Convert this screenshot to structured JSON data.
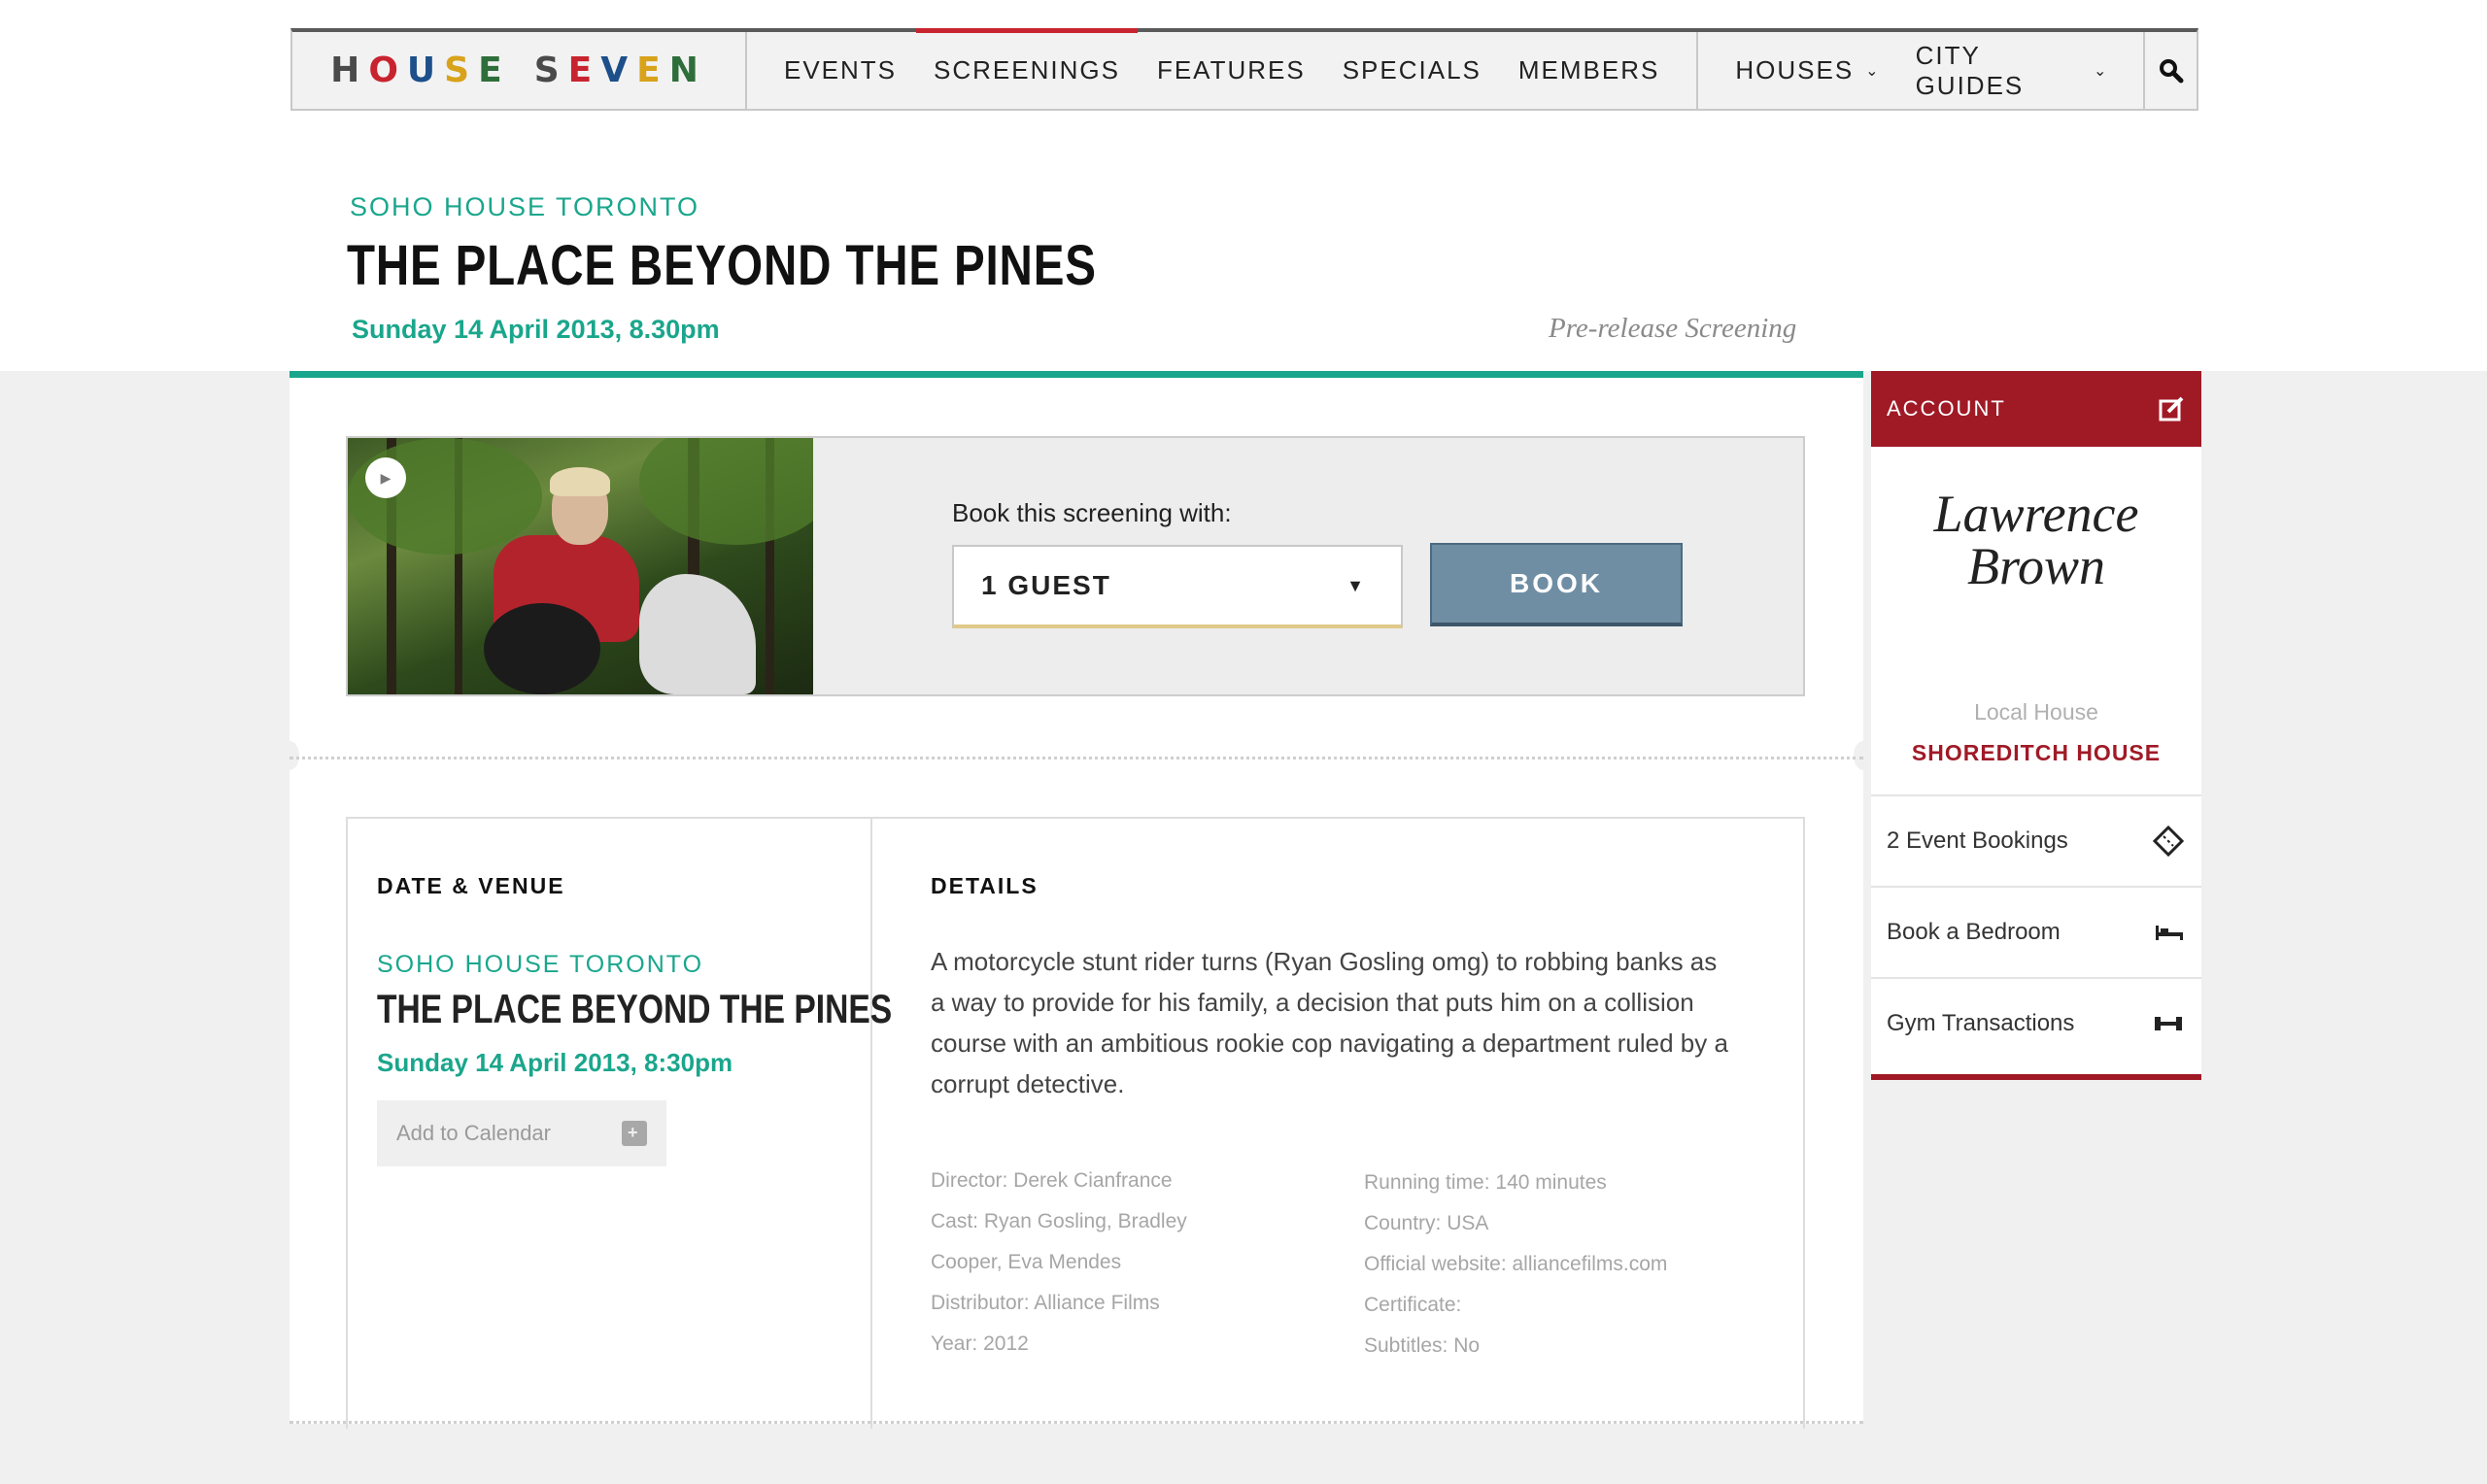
{
  "nav": {
    "logo_letters": [
      "H",
      "O",
      "U",
      "S",
      "E",
      " ",
      "S",
      "E",
      "V",
      "E",
      "N"
    ],
    "logo_colors": [
      "#4a4a4a",
      "#c8242f",
      "#1d4f8a",
      "#d8a21a",
      "#2e6e3a",
      "#000",
      "#4a4a4a",
      "#c8242f",
      "#1d4f8a",
      "#d8a21a",
      "#2e6e3a"
    ],
    "items": [
      "EVENTS",
      "SCREENINGS",
      "FEATURES",
      "SPECIALS",
      "MEMBERS"
    ],
    "active": "SCREENINGS",
    "right": [
      "HOUSES",
      "CITY GUIDES"
    ],
    "search_icon": "search-icon"
  },
  "header": {
    "house": "SOHO HOUSE TORONTO",
    "title": "THE PLACE BEYOND THE PINES",
    "date": "Sunday 14 April 2013, 8.30pm",
    "tag": "Pre-release Screening"
  },
  "booking": {
    "label": "Book this screening with:",
    "guest_value": "1 GUEST",
    "book_label": "BOOK"
  },
  "venue": {
    "heading": "DATE & VENUE",
    "house": "SOHO HOUSE TORONTO",
    "title": "THE PLACE BEYOND THE PINES",
    "date": "Sunday 14 April 2013, 8:30pm",
    "calendar_label": "Add to Calendar"
  },
  "details": {
    "heading": "DETAILS",
    "description": "A motorcycle stunt rider turns (Ryan Gosling omg) to robbing banks as a way to provide for his family, a decision that puts him on a collision course with an ambitious rookie cop navigating a department ruled by a corrupt detective.",
    "meta_left": [
      "Director: Derek Cianfrance",
      "Cast: Ryan Gosling, Bradley",
      "Cooper, Eva Mendes",
      "Distributor: Alliance Films",
      "Year: 2012"
    ],
    "meta_right": [
      "Running time: 140 minutes",
      "Country: USA",
      "Official website: alliancefilms.com",
      "Certificate:",
      "Subtitles: No"
    ]
  },
  "account": {
    "heading": "ACCOUNT",
    "name_first": "Lawrence",
    "name_last": "Brown",
    "local_label": "Local House",
    "local_value": "SHOREDITCH HOUSE",
    "items": [
      {
        "label": "2 Event Bookings",
        "icon": "ticket-icon",
        "glyph": "⬦"
      },
      {
        "label": "Book a Bedroom",
        "icon": "bed-icon",
        "glyph": "⊢"
      },
      {
        "label": "Gym Transactions",
        "icon": "dumbbell-icon",
        "glyph": "⊷"
      }
    ]
  },
  "colors": {
    "accent_green": "#1aa68c",
    "account_red": "#a01a26",
    "nav_active": "#c8242f",
    "book_button": "#6f8ea4"
  }
}
